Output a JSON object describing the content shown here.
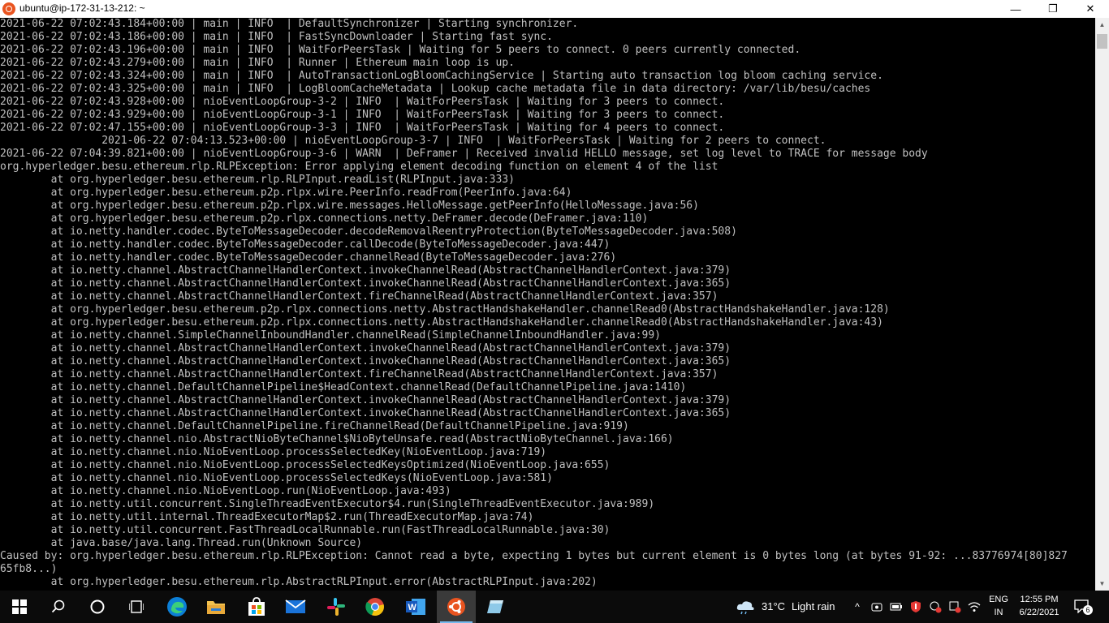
{
  "window": {
    "title": "ubuntu@ip-172-31-13-212: ~",
    "minimize_glyph": "—",
    "maximize_glyph": "❐",
    "close_glyph": "✕"
  },
  "terminal": {
    "lines": [
      "2021-06-22 07:02:43.184+00:00 | main | INFO  | DefaultSynchronizer | Starting synchronizer.",
      "2021-06-22 07:02:43.186+00:00 | main | INFO  | FastSyncDownloader | Starting fast sync.",
      "2021-06-22 07:02:43.196+00:00 | main | INFO  | WaitForPeersTask | Waiting for 5 peers to connect. 0 peers currently connected.",
      "2021-06-22 07:02:43.279+00:00 | main | INFO  | Runner | Ethereum main loop is up.",
      "2021-06-22 07:02:43.324+00:00 | main | INFO  | AutoTransactionLogBloomCachingService | Starting auto transaction log bloom caching service.",
      "2021-06-22 07:02:43.325+00:00 | main | INFO  | LogBloomCacheMetadata | Lookup cache metadata file in data directory: /var/lib/besu/caches",
      "2021-06-22 07:02:43.928+00:00 | nioEventLoopGroup-3-2 | INFO  | WaitForPeersTask | Waiting for 3 peers to connect.",
      "2021-06-22 07:02:43.929+00:00 | nioEventLoopGroup-3-1 | INFO  | WaitForPeersTask | Waiting for 3 peers to connect.",
      "2021-06-22 07:02:47.155+00:00 | nioEventLoopGroup-3-3 | INFO  | WaitForPeersTask | Waiting for 4 peers to connect.",
      "                2021-06-22 07:04:13.523+00:00 | nioEventLoopGroup-3-7 | INFO  | WaitForPeersTask | Waiting for 2 peers to connect.",
      "2021-06-22 07:04:39.821+00:00 | nioEventLoopGroup-3-6 | WARN  | DeFramer | Received invalid HELLO message, set log level to TRACE for message body",
      "org.hyperledger.besu.ethereum.rlp.RLPException: Error applying element decoding function on element 4 of the list",
      "        at org.hyperledger.besu.ethereum.rlp.RLPInput.readList(RLPInput.java:333)",
      "        at org.hyperledger.besu.ethereum.p2p.rlpx.wire.PeerInfo.readFrom(PeerInfo.java:64)",
      "        at org.hyperledger.besu.ethereum.p2p.rlpx.wire.messages.HelloMessage.getPeerInfo(HelloMessage.java:56)",
      "        at org.hyperledger.besu.ethereum.p2p.rlpx.connections.netty.DeFramer.decode(DeFramer.java:110)",
      "        at io.netty.handler.codec.ByteToMessageDecoder.decodeRemovalReentryProtection(ByteToMessageDecoder.java:508)",
      "        at io.netty.handler.codec.ByteToMessageDecoder.callDecode(ByteToMessageDecoder.java:447)",
      "        at io.netty.handler.codec.ByteToMessageDecoder.channelRead(ByteToMessageDecoder.java:276)",
      "        at io.netty.channel.AbstractChannelHandlerContext.invokeChannelRead(AbstractChannelHandlerContext.java:379)",
      "        at io.netty.channel.AbstractChannelHandlerContext.invokeChannelRead(AbstractChannelHandlerContext.java:365)",
      "        at io.netty.channel.AbstractChannelHandlerContext.fireChannelRead(AbstractChannelHandlerContext.java:357)",
      "        at org.hyperledger.besu.ethereum.p2p.rlpx.connections.netty.AbstractHandshakeHandler.channelRead0(AbstractHandshakeHandler.java:128)",
      "        at org.hyperledger.besu.ethereum.p2p.rlpx.connections.netty.AbstractHandshakeHandler.channelRead0(AbstractHandshakeHandler.java:43)",
      "        at io.netty.channel.SimpleChannelInboundHandler.channelRead(SimpleChannelInboundHandler.java:99)",
      "        at io.netty.channel.AbstractChannelHandlerContext.invokeChannelRead(AbstractChannelHandlerContext.java:379)",
      "        at io.netty.channel.AbstractChannelHandlerContext.invokeChannelRead(AbstractChannelHandlerContext.java:365)",
      "        at io.netty.channel.AbstractChannelHandlerContext.fireChannelRead(AbstractChannelHandlerContext.java:357)",
      "        at io.netty.channel.DefaultChannelPipeline$HeadContext.channelRead(DefaultChannelPipeline.java:1410)",
      "        at io.netty.channel.AbstractChannelHandlerContext.invokeChannelRead(AbstractChannelHandlerContext.java:379)",
      "        at io.netty.channel.AbstractChannelHandlerContext.invokeChannelRead(AbstractChannelHandlerContext.java:365)",
      "        at io.netty.channel.DefaultChannelPipeline.fireChannelRead(DefaultChannelPipeline.java:919)",
      "        at io.netty.channel.nio.AbstractNioByteChannel$NioByteUnsafe.read(AbstractNioByteChannel.java:166)",
      "        at io.netty.channel.nio.NioEventLoop.processSelectedKey(NioEventLoop.java:719)",
      "        at io.netty.channel.nio.NioEventLoop.processSelectedKeysOptimized(NioEventLoop.java:655)",
      "        at io.netty.channel.nio.NioEventLoop.processSelectedKeys(NioEventLoop.java:581)",
      "        at io.netty.channel.nio.NioEventLoop.run(NioEventLoop.java:493)",
      "        at io.netty.util.concurrent.SingleThreadEventExecutor$4.run(SingleThreadEventExecutor.java:989)",
      "        at io.netty.util.internal.ThreadExecutorMap$2.run(ThreadExecutorMap.java:74)",
      "        at io.netty.util.concurrent.FastThreadLocalRunnable.run(FastThreadLocalRunnable.java:30)",
      "        at java.base/java.lang.Thread.run(Unknown Source)",
      "Caused by: org.hyperledger.besu.ethereum.rlp.RLPException: Cannot read a byte, expecting 1 bytes but current element is 0 bytes long (at bytes 91-92: ...83776974[80]827",
      "65fb8...)",
      "        at org.hyperledger.besu.ethereum.rlp.AbstractRLPInput.error(AbstractRLPInput.java:202)"
    ]
  },
  "scrollbar": {
    "up_glyph": "▲",
    "down_glyph": "▼"
  },
  "taskbar": {
    "apps": [
      {
        "name": "start-button",
        "icon": "windows-logo-icon",
        "active": false
      },
      {
        "name": "search-button",
        "icon": "search-icon",
        "active": false
      },
      {
        "name": "cortana-button",
        "icon": "circle-icon",
        "active": false
      },
      {
        "name": "task-view-button",
        "icon": "task-view-icon",
        "active": false
      },
      {
        "name": "edge-button",
        "icon": "edge-icon",
        "active": false
      },
      {
        "name": "file-explorer-button",
        "icon": "folder-icon",
        "active": false
      },
      {
        "name": "store-button",
        "icon": "store-icon",
        "active": false
      },
      {
        "name": "mail-button",
        "icon": "mail-icon",
        "active": false
      },
      {
        "name": "slack-button",
        "icon": "slack-icon",
        "active": false
      },
      {
        "name": "chrome-button",
        "icon": "chrome-icon",
        "active": false
      },
      {
        "name": "word-button",
        "icon": "word-icon",
        "active": false
      },
      {
        "name": "ubuntu-button",
        "icon": "ubuntu-icon",
        "active": true
      },
      {
        "name": "notes-button",
        "icon": "notes-icon",
        "active": false
      }
    ],
    "weather": {
      "temperature": "31°C",
      "condition": "Light rain"
    },
    "language": {
      "line1": "ENG",
      "line2": "IN"
    },
    "clock": {
      "time": "12:55 PM",
      "date": "6/22/2021"
    },
    "notifications": {
      "count": "6"
    },
    "colors": {
      "accent": "#76b9ed",
      "ubuntu": "#e95420"
    }
  }
}
